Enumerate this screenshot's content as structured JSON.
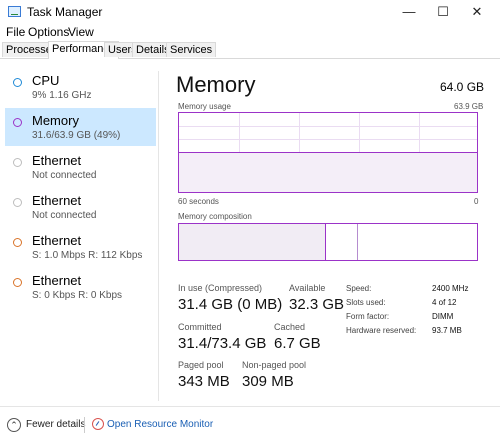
{
  "window": {
    "title": "Task Manager",
    "controls": {
      "minimize": "—",
      "maximize": "☐",
      "close": "✕"
    }
  },
  "menu": [
    "File",
    "Options",
    "View"
  ],
  "tabs": [
    "Processes",
    "Performance",
    "Users",
    "Details",
    "Services"
  ],
  "active_tab": "Performance",
  "resources": [
    {
      "title": "CPU",
      "subtitle": "9%  1.16 GHz",
      "color": "#1f8ad6",
      "selected": false
    },
    {
      "title": "Memory",
      "subtitle": "31.6/63.9 GB (49%)",
      "color": "#9b33c8",
      "selected": true
    },
    {
      "title": "Ethernet",
      "subtitle": "Not connected",
      "color": "#bdbdbd",
      "selected": false
    },
    {
      "title": "Ethernet",
      "subtitle": "Not connected",
      "color": "#bdbdbd",
      "selected": false
    },
    {
      "title": "Ethernet",
      "subtitle": "S: 1.0 Mbps  R: 112 Kbps",
      "color": "#d9742a",
      "selected": false
    },
    {
      "title": "Ethernet",
      "subtitle": "S: 0 Kbps  R: 0 Kbps",
      "color": "#d9742a",
      "selected": false
    }
  ],
  "memory": {
    "heading": "Memory",
    "total": "64.0 GB",
    "usage_label": "Memory usage",
    "usage_max": "63.9 GB",
    "time_left": "60 seconds",
    "time_right": "0",
    "usage_fraction": 0.49,
    "composition_label": "Memory composition",
    "composition_in_use_fraction": 0.49,
    "stats": {
      "in_use_label": "In use (Compressed)",
      "in_use_value": "31.4 GB (0 MB)",
      "available_label": "Available",
      "available_value": "32.3 GB",
      "committed_label": "Committed",
      "committed_value": "31.4/73.4 GB",
      "cached_label": "Cached",
      "cached_value": "6.7 GB",
      "paged_label": "Paged pool",
      "paged_value": "343 MB",
      "nonpaged_label": "Non-paged pool",
      "nonpaged_value": "309 MB"
    },
    "details": [
      {
        "label": "Speed:",
        "value": "2400 MHz"
      },
      {
        "label": "Slots used:",
        "value": "4 of 12"
      },
      {
        "label": "Form factor:",
        "value": "DIMM"
      },
      {
        "label": "Hardware reserved:",
        "value": "93.7 MB"
      }
    ]
  },
  "footer": {
    "fewer_details": "Fewer details",
    "resource_monitor": "Open Resource Monitor"
  }
}
